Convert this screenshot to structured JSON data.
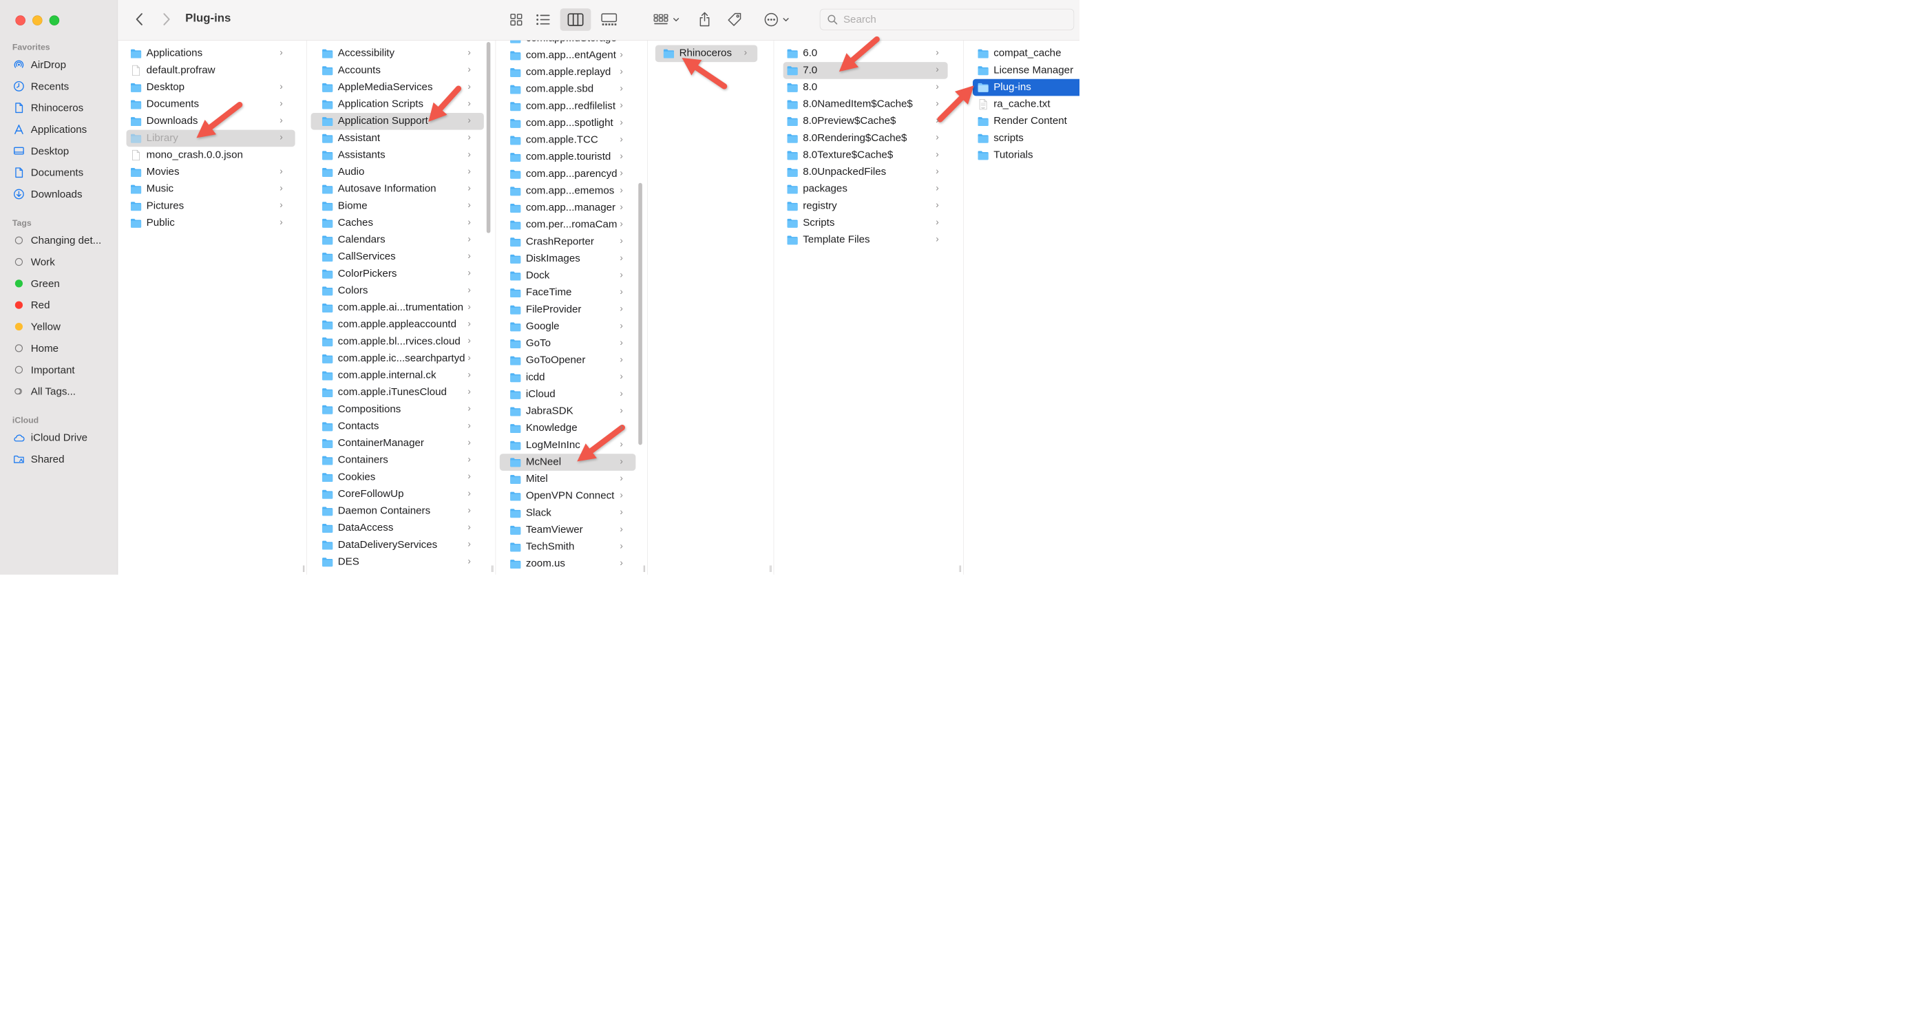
{
  "window": {
    "title": "Plug-ins"
  },
  "toolbar": {
    "search_placeholder": "Search",
    "view_modes": [
      "icon-view-icon",
      "list-view-icon",
      "column-view-icon",
      "gallery-view-icon"
    ],
    "active_view": "column-view-icon"
  },
  "sidebar": {
    "favorites_label": "Favorites",
    "favorites": [
      {
        "label": "AirDrop",
        "icon": "airdrop-icon"
      },
      {
        "label": "Recents",
        "icon": "clock-icon"
      },
      {
        "label": "Rhinoceros",
        "icon": "document-icon"
      },
      {
        "label": "Applications",
        "icon": "applications-icon"
      },
      {
        "label": "Desktop",
        "icon": "desktop-icon"
      },
      {
        "label": "Documents",
        "icon": "document-icon"
      },
      {
        "label": "Downloads",
        "icon": "download-icon"
      }
    ],
    "tags_label": "Tags",
    "tags": [
      {
        "label": "Changing det...",
        "color": "empty"
      },
      {
        "label": "Work",
        "color": "empty"
      },
      {
        "label": "Green",
        "color": "#28c840"
      },
      {
        "label": "Red",
        "color": "#fe3b30"
      },
      {
        "label": "Yellow",
        "color": "#febc2e"
      },
      {
        "label": "Home",
        "color": "empty"
      },
      {
        "label": "Important",
        "color": "empty"
      },
      {
        "label": "All Tags...",
        "color": "all"
      }
    ],
    "icloud_label": "iCloud",
    "icloud": [
      {
        "label": "iCloud Drive",
        "icon": "cloud-icon"
      },
      {
        "label": "Shared",
        "icon": "shared-folder-icon"
      }
    ]
  },
  "columns": [
    {
      "items": [
        {
          "label": "Applications",
          "type": "folder",
          "chevron": true
        },
        {
          "label": "default.profraw",
          "type": "file",
          "chevron": false
        },
        {
          "label": "Desktop",
          "type": "folder",
          "chevron": true
        },
        {
          "label": "Documents",
          "type": "folder",
          "chevron": true
        },
        {
          "label": "Downloads",
          "type": "folder",
          "chevron": true
        },
        {
          "label": "Library",
          "type": "folder",
          "chevron": true,
          "state": "selected-dim"
        },
        {
          "label": "mono_crash.0.0.json",
          "type": "file",
          "chevron": false
        },
        {
          "label": "Movies",
          "type": "folder",
          "chevron": true
        },
        {
          "label": "Music",
          "type": "folder",
          "chevron": true
        },
        {
          "label": "Pictures",
          "type": "folder",
          "chevron": true
        },
        {
          "label": "Public",
          "type": "folder",
          "chevron": true
        }
      ]
    },
    {
      "items": [
        {
          "label": "Accessibility",
          "type": "folder",
          "chevron": true
        },
        {
          "label": "Accounts",
          "type": "folder",
          "chevron": true
        },
        {
          "label": "AppleMediaServices",
          "type": "folder",
          "chevron": true
        },
        {
          "label": "Application Scripts",
          "type": "folder",
          "chevron": true
        },
        {
          "label": "Application Support",
          "type": "folder",
          "chevron": true,
          "state": "selected"
        },
        {
          "label": "Assistant",
          "type": "folder",
          "chevron": true
        },
        {
          "label": "Assistants",
          "type": "folder",
          "chevron": true
        },
        {
          "label": "Audio",
          "type": "folder",
          "chevron": true
        },
        {
          "label": "Autosave Information",
          "type": "folder",
          "chevron": true
        },
        {
          "label": "Biome",
          "type": "folder",
          "chevron": true
        },
        {
          "label": "Caches",
          "type": "folder",
          "chevron": true
        },
        {
          "label": "Calendars",
          "type": "folder",
          "chevron": true
        },
        {
          "label": "CallServices",
          "type": "folder",
          "chevron": true
        },
        {
          "label": "ColorPickers",
          "type": "folder",
          "chevron": true
        },
        {
          "label": "Colors",
          "type": "folder",
          "chevron": true
        },
        {
          "label": "com.apple.ai...trumentation",
          "type": "folder",
          "chevron": true
        },
        {
          "label": "com.apple.appleaccountd",
          "type": "folder",
          "chevron": true
        },
        {
          "label": "com.apple.bl...rvices.cloud",
          "type": "folder",
          "chevron": true
        },
        {
          "label": "com.apple.ic...searchpartyd",
          "type": "folder",
          "chevron": true
        },
        {
          "label": "com.apple.internal.ck",
          "type": "folder",
          "chevron": true
        },
        {
          "label": "com.apple.iTunesCloud",
          "type": "folder",
          "chevron": true
        },
        {
          "label": "Compositions",
          "type": "folder",
          "chevron": true
        },
        {
          "label": "Contacts",
          "type": "folder",
          "chevron": true
        },
        {
          "label": "ContainerManager",
          "type": "folder",
          "chevron": true
        },
        {
          "label": "Containers",
          "type": "folder",
          "chevron": true
        },
        {
          "label": "Cookies",
          "type": "folder",
          "chevron": true
        },
        {
          "label": "CoreFollowUp",
          "type": "folder",
          "chevron": true
        },
        {
          "label": "Daemon Containers",
          "type": "folder",
          "chevron": true
        },
        {
          "label": "DataAccess",
          "type": "folder",
          "chevron": true
        },
        {
          "label": "DataDeliveryServices",
          "type": "folder",
          "chevron": true
        },
        {
          "label": "DES",
          "type": "folder",
          "chevron": true
        }
      ]
    },
    {
      "items": [
        {
          "label": "com.app...dStorage",
          "type": "folder",
          "chevron": true
        },
        {
          "label": "com.app...entAgent",
          "type": "folder",
          "chevron": true
        },
        {
          "label": "com.apple.replayd",
          "type": "folder",
          "chevron": true
        },
        {
          "label": "com.apple.sbd",
          "type": "folder",
          "chevron": true
        },
        {
          "label": "com.app...redfilelist",
          "type": "folder",
          "chevron": true
        },
        {
          "label": "com.app...spotlight",
          "type": "folder",
          "chevron": true
        },
        {
          "label": "com.apple.TCC",
          "type": "folder",
          "chevron": true
        },
        {
          "label": "com.apple.touristd",
          "type": "folder",
          "chevron": true
        },
        {
          "label": "com.app...parencyd",
          "type": "folder",
          "chevron": true
        },
        {
          "label": "com.app...ememos",
          "type": "folder",
          "chevron": true
        },
        {
          "label": "com.app...manager",
          "type": "folder",
          "chevron": true
        },
        {
          "label": "com.per...romaCam",
          "type": "folder",
          "chevron": true
        },
        {
          "label": "CrashReporter",
          "type": "folder",
          "chevron": true
        },
        {
          "label": "DiskImages",
          "type": "folder",
          "chevron": true
        },
        {
          "label": "Dock",
          "type": "folder",
          "chevron": true
        },
        {
          "label": "FaceTime",
          "type": "folder",
          "chevron": true
        },
        {
          "label": "FileProvider",
          "type": "folder",
          "chevron": true
        },
        {
          "label": "Google",
          "type": "folder",
          "chevron": true
        },
        {
          "label": "GoTo",
          "type": "folder",
          "chevron": true
        },
        {
          "label": "GoToOpener",
          "type": "folder",
          "chevron": true
        },
        {
          "label": "icdd",
          "type": "folder",
          "chevron": true
        },
        {
          "label": "iCloud",
          "type": "folder",
          "chevron": true
        },
        {
          "label": "JabraSDK",
          "type": "folder",
          "chevron": true
        },
        {
          "label": "Knowledge",
          "type": "folder",
          "chevron": true
        },
        {
          "label": "LogMeInInc",
          "type": "folder",
          "chevron": true
        },
        {
          "label": "McNeel",
          "type": "folder",
          "chevron": true,
          "state": "selected"
        },
        {
          "label": "Mitel",
          "type": "folder",
          "chevron": true
        },
        {
          "label": "OpenVPN Connect",
          "type": "folder",
          "chevron": true
        },
        {
          "label": "Slack",
          "type": "folder",
          "chevron": true
        },
        {
          "label": "TeamViewer",
          "type": "folder",
          "chevron": true
        },
        {
          "label": "TechSmith",
          "type": "folder",
          "chevron": true
        },
        {
          "label": "zoom.us",
          "type": "folder",
          "chevron": true
        }
      ]
    },
    {
      "items": [
        {
          "label": "Rhinoceros",
          "type": "folder",
          "chevron": true,
          "state": "selected"
        }
      ]
    },
    {
      "items": [
        {
          "label": "6.0",
          "type": "folder",
          "chevron": true
        },
        {
          "label": "7.0",
          "type": "folder",
          "chevron": true,
          "state": "selected"
        },
        {
          "label": "8.0",
          "type": "folder",
          "chevron": true
        },
        {
          "label": "8.0NamedItem$Cache$",
          "type": "folder",
          "chevron": true
        },
        {
          "label": "8.0Preview$Cache$",
          "type": "folder",
          "chevron": true
        },
        {
          "label": "8.0Rendering$Cache$",
          "type": "folder",
          "chevron": true
        },
        {
          "label": "8.0Texture$Cache$",
          "type": "folder",
          "chevron": true
        },
        {
          "label": "8.0UnpackedFiles",
          "type": "folder",
          "chevron": true
        },
        {
          "label": "packages",
          "type": "folder",
          "chevron": true
        },
        {
          "label": "registry",
          "type": "folder",
          "chevron": true
        },
        {
          "label": "Scripts",
          "type": "folder",
          "chevron": true
        },
        {
          "label": "Template Files",
          "type": "folder",
          "chevron": true
        }
      ]
    },
    {
      "items": [
        {
          "label": "compat_cache",
          "type": "folder",
          "chevron": false
        },
        {
          "label": "License Manager",
          "type": "folder",
          "chevron": false
        },
        {
          "label": "Plug-ins",
          "type": "folder",
          "chevron": false,
          "state": "active"
        },
        {
          "label": "ra_cache.txt",
          "type": "text-file",
          "chevron": false
        },
        {
          "label": "Render Content",
          "type": "folder",
          "chevron": false
        },
        {
          "label": "scripts",
          "type": "folder",
          "chevron": false
        },
        {
          "label": "Tutorials",
          "type": "folder",
          "chevron": false
        }
      ]
    }
  ],
  "annotation_color": "#f1574a",
  "colors": {
    "folder_fill": "#5ac8fa",
    "selection_blue": "#1e69d6",
    "selection_gray": "#dcdbdb"
  }
}
